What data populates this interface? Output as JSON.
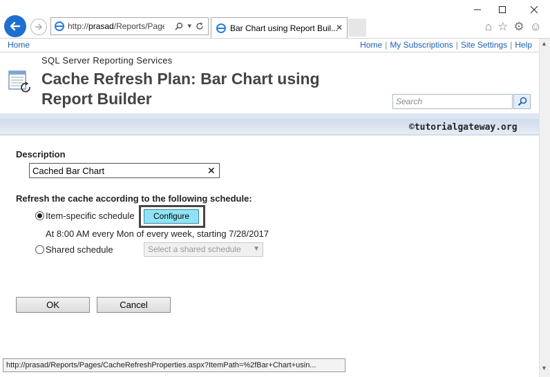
{
  "browser": {
    "url_prefix": "http://",
    "url_host": "prasad",
    "url_rest": "/Reports/Pages",
    "tab_title": "Bar Chart using Report Buil..."
  },
  "topbar": {
    "home_left": "Home",
    "links": [
      "Home",
      "My Subscriptions",
      "Site Settings",
      "Help"
    ],
    "separator": "|"
  },
  "header": {
    "product": "SQL Server Reporting Services",
    "title": "Cache Refresh Plan: Bar Chart using Report Builder",
    "search_placeholder": "Search"
  },
  "watermark": "©tutorialgateway.org",
  "form": {
    "description_label": "Description",
    "description_value": "Cached Bar Chart",
    "refresh_label": "Refresh the cache according to the following schedule:",
    "item_specific_label": "Item-specific schedule",
    "configure_label": "Configure",
    "schedule_text": "At 8:00 AM every Mon of every week, starting 7/28/2017",
    "shared_label": "Shared schedule",
    "shared_placeholder": "Select a shared schedule",
    "ok_label": "OK",
    "cancel_label": "Cancel"
  },
  "status_text": "http://prasad/Reports/Pages/CacheRefreshProperties.aspx?ItemPath=%2fBar+Chart+usin...",
  "colors": {
    "link": "#1a5fb0",
    "accent_button": "#8fe3f5",
    "back_button": "#1e6fd0"
  }
}
